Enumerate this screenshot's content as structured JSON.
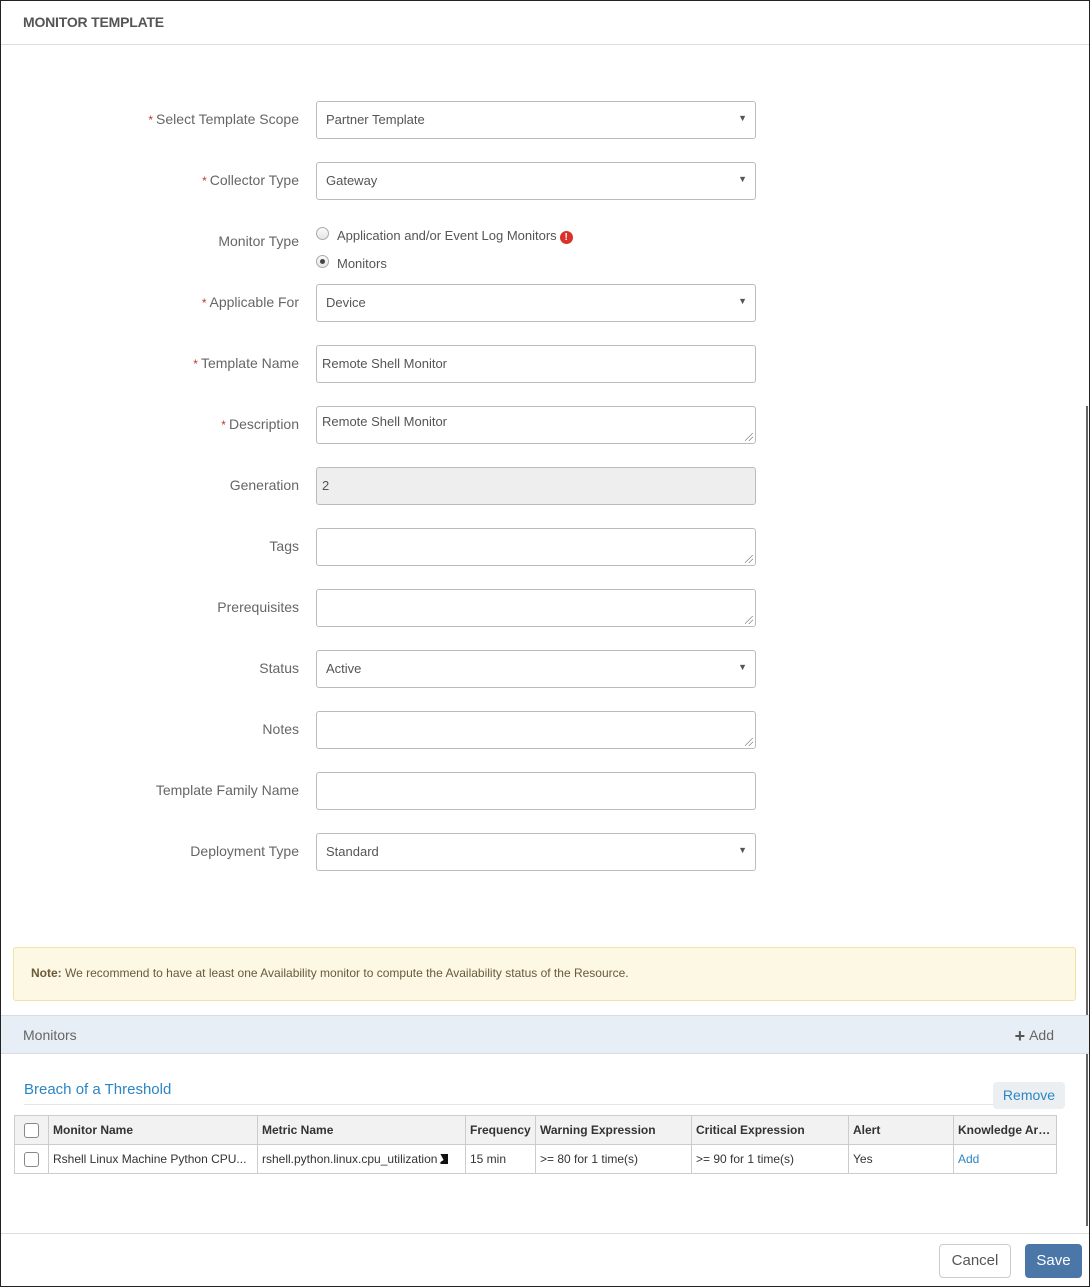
{
  "header": {
    "title": "MONITOR TEMPLATE"
  },
  "form": {
    "template_scope": {
      "label": "Select Template Scope",
      "required": true,
      "value": "Partner Template"
    },
    "collector_type": {
      "label": "Collector Type",
      "required": true,
      "value": "Gateway"
    },
    "monitor_type": {
      "label": "Monitor Type",
      "options": [
        {
          "label": "Application and/or Event Log Monitors",
          "checked": false,
          "warning_icon": "exclamation-circle-icon"
        },
        {
          "label": "Monitors",
          "checked": true
        }
      ]
    },
    "applicable_for": {
      "label": "Applicable For",
      "required": true,
      "value": "Device"
    },
    "template_name": {
      "label": "Template Name",
      "required": true,
      "value": "Remote Shell Monitor"
    },
    "description": {
      "label": "Description",
      "required": true,
      "value": "Remote Shell Monitor"
    },
    "generation": {
      "label": "Generation",
      "value": "2"
    },
    "tags": {
      "label": "Tags",
      "value": ""
    },
    "prerequisites": {
      "label": "Prerequisites",
      "value": ""
    },
    "status": {
      "label": "Status",
      "value": "Active"
    },
    "notes": {
      "label": "Notes",
      "value": ""
    },
    "template_family_name": {
      "label": "Template Family Name",
      "value": ""
    },
    "deployment_type": {
      "label": "Deployment Type",
      "value": "Standard"
    },
    "required_marker": "*",
    "select_caret": "▼"
  },
  "note": {
    "prefix": "Note:",
    "text": " We recommend to have at least one Availability monitor to compute the Availability status of the Resource."
  },
  "monitors": {
    "title": "Monitors",
    "add_label": "Add",
    "add_icon": "+",
    "section_title": "Breach of a Threshold",
    "remove_label": "Remove",
    "columns": [
      "Monitor Name",
      "Metric Name",
      "Frequency",
      "Warning Expression",
      "Critical Expression",
      "Alert",
      "Knowledge Art..."
    ],
    "rows": [
      {
        "monitor_name": "Rshell Linux Machine Python CPU...",
        "metric_name": "rshell.python.linux.cpu_utilization",
        "frequency": "15 min",
        "warning_expression": ">= 80 for 1 time(s)",
        "critical_expression": ">= 90 for 1 time(s)",
        "alert": "Yes",
        "knowledge_article": "Add"
      }
    ]
  },
  "footer": {
    "cancel_label": "Cancel",
    "save_label": "Save"
  },
  "colors": {
    "accent": "#2a86c5",
    "primary_button": "#4a76a8",
    "required": "#c0392b",
    "note_bg": "#fcf8e3",
    "monitors_bar_bg": "#e8eef5"
  }
}
